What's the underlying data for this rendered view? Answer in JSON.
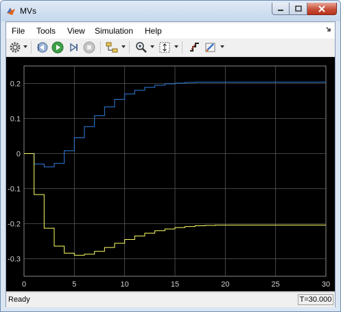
{
  "window": {
    "title": "MVs"
  },
  "menu": {
    "items": [
      "File",
      "Tools",
      "View",
      "Simulation",
      "Help"
    ]
  },
  "toolbar": {
    "icons": [
      "gear-icon",
      "step-back-icon",
      "run-icon",
      "step-forward-icon",
      "stop-icon",
      "highlight-icon",
      "zoom-icon",
      "autoscale-icon",
      "signal-icon",
      "style-icon"
    ]
  },
  "status": {
    "ready": "Ready",
    "time": "T=30.000"
  },
  "colors": {
    "series1": "#2f7fe0",
    "series2": "#ffff66",
    "background": "#000000",
    "grid": "#5a5a5a"
  },
  "chart_data": {
    "type": "line",
    "xlim": [
      0,
      30
    ],
    "ylim": [
      -0.35,
      0.25
    ],
    "xticks": [
      0,
      5,
      10,
      15,
      20,
      25,
      30
    ],
    "yticks": [
      0.2,
      0.1,
      0,
      -0.1,
      -0.2,
      -0.3
    ],
    "ytick_labels": [
      "0.2",
      "0.1",
      "0",
      "-0.1",
      "-0.2",
      "-0.3"
    ],
    "grid": true,
    "series": [
      {
        "color": "#2f7fe0",
        "step": true,
        "x": [
          0,
          1,
          2,
          3,
          4,
          5,
          6,
          7,
          8,
          9,
          10,
          11,
          12,
          13,
          14,
          15,
          16,
          17,
          18,
          19,
          20,
          21,
          22,
          23,
          24,
          25,
          26,
          27,
          28,
          29,
          30
        ],
        "y": [
          0.0,
          -0.03,
          -0.038,
          -0.028,
          0.008,
          0.045,
          0.077,
          0.108,
          0.133,
          0.155,
          0.17,
          0.181,
          0.189,
          0.195,
          0.199,
          0.201,
          0.203,
          0.204,
          0.204,
          0.204,
          0.204,
          0.204,
          0.204,
          0.204,
          0.204,
          0.204,
          0.204,
          0.204,
          0.204,
          0.204,
          0.204
        ]
      },
      {
        "color": "#ffff66",
        "step": true,
        "x": [
          0,
          1,
          2,
          3,
          4,
          5,
          6,
          7,
          8,
          9,
          10,
          11,
          12,
          13,
          14,
          15,
          16,
          17,
          18,
          19,
          20,
          21,
          22,
          23,
          24,
          25,
          26,
          27,
          28,
          29,
          30
        ],
        "y": [
          0.0,
          -0.117,
          -0.213,
          -0.264,
          -0.284,
          -0.29,
          -0.287,
          -0.279,
          -0.268,
          -0.256,
          -0.245,
          -0.235,
          -0.227,
          -0.22,
          -0.215,
          -0.211,
          -0.208,
          -0.206,
          -0.205,
          -0.204,
          -0.204,
          -0.204,
          -0.204,
          -0.204,
          -0.204,
          -0.204,
          -0.204,
          -0.204,
          -0.204,
          -0.204,
          -0.204
        ]
      }
    ]
  }
}
